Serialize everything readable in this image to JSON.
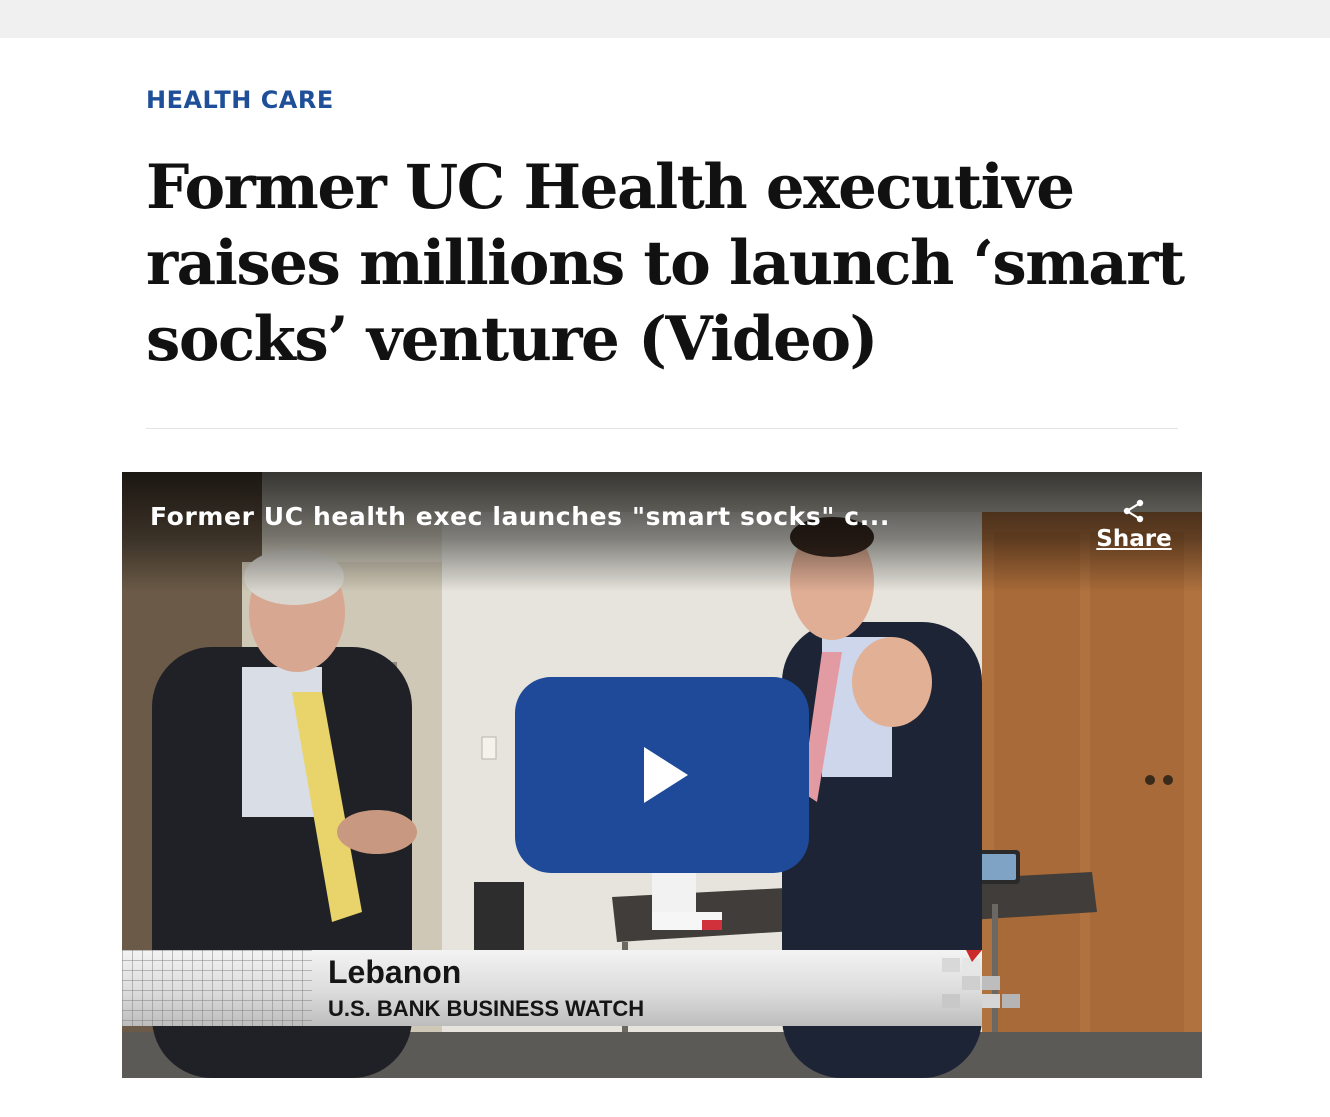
{
  "article": {
    "category": "HEALTH CARE",
    "headline": "Former UC Health executive raises millions to launch ‘smart socks’ venture (Video)"
  },
  "video": {
    "title": "Former UC health exec launches \"smart socks\" c...",
    "share_label": "Share",
    "lower_third": {
      "location": "Lebanon",
      "program": "U.S. BANK BUSINESS WATCH"
    },
    "icons": {
      "share": "share-icon",
      "play": "play-icon"
    }
  },
  "colors": {
    "category": "#1f4f99",
    "play_button": "#1e4a99",
    "top_bar": "#f0f0f0",
    "divider": "#e3e3e3"
  }
}
